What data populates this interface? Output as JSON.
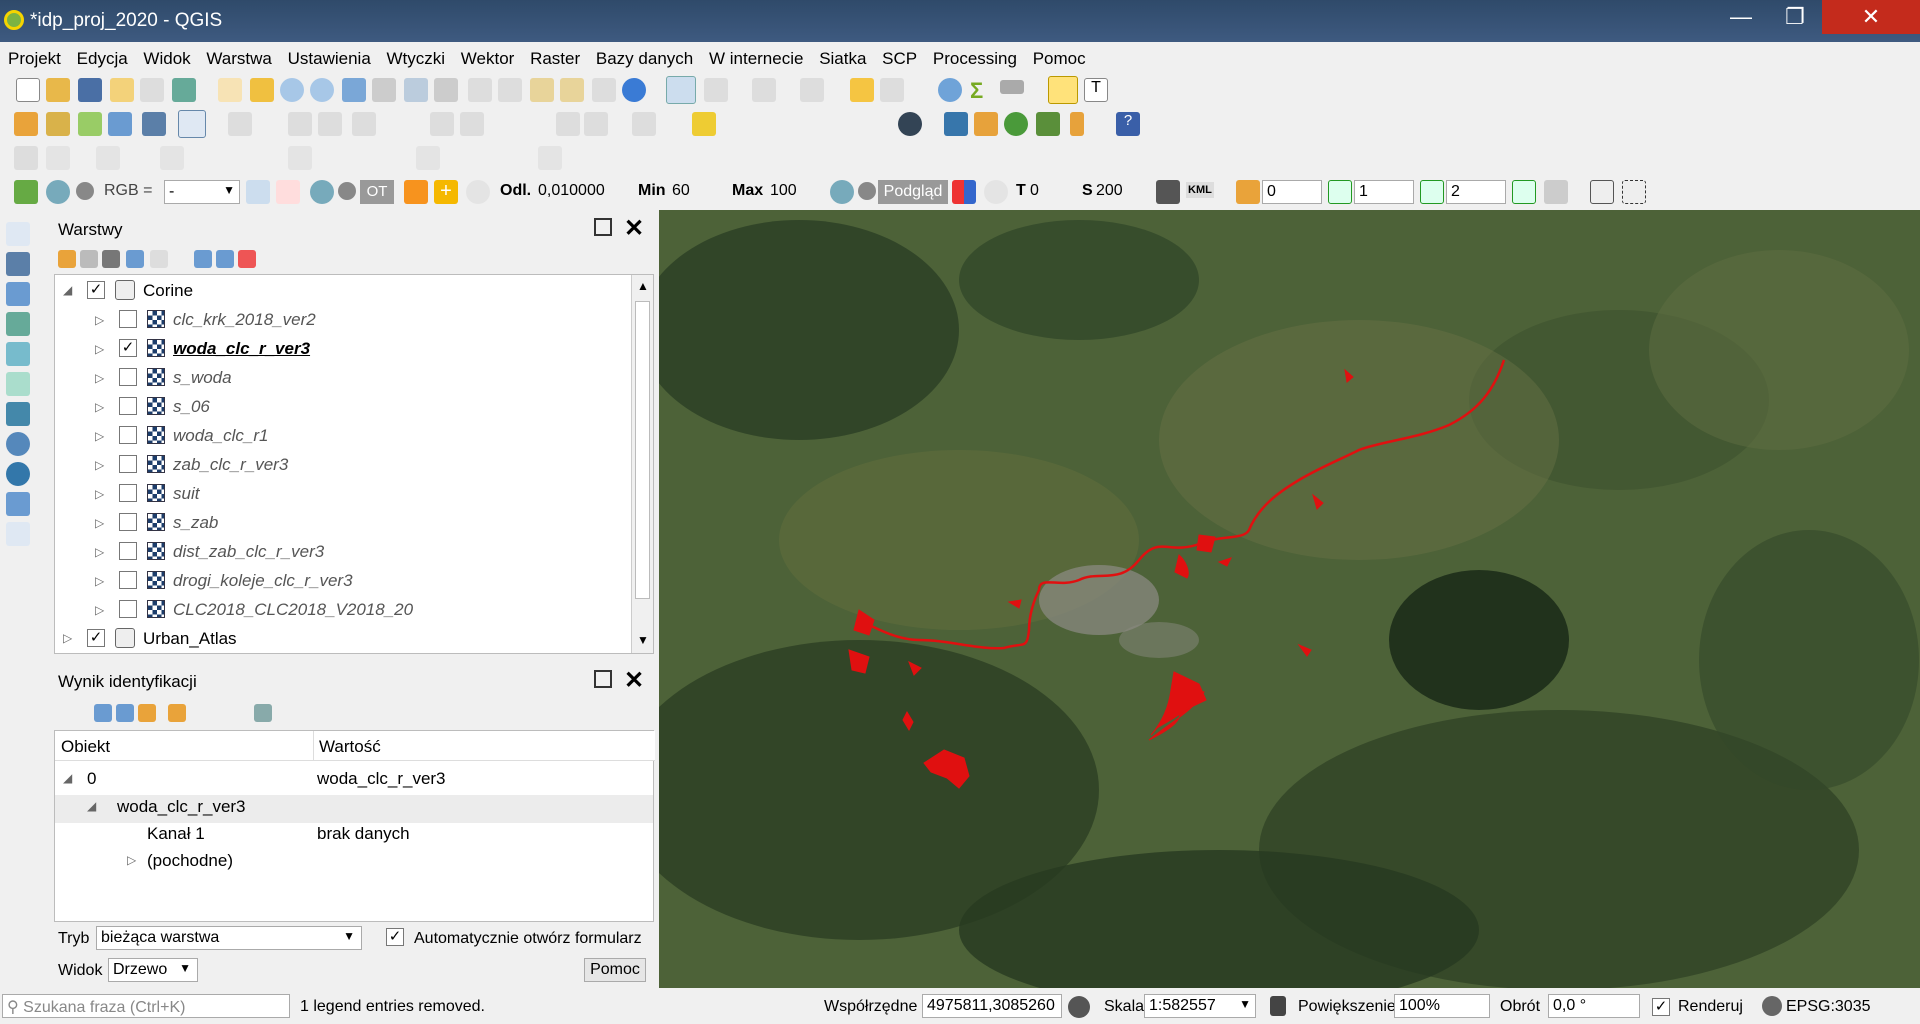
{
  "window": {
    "title": "*idp_proj_2020 - QGIS",
    "min": "—",
    "max": "❐",
    "close": "✕"
  },
  "menu": [
    "Projekt",
    "Edycja",
    "Widok",
    "Warstwa",
    "Ustawienia",
    "Wtyczki",
    "Wektor",
    "Raster",
    "Bazy danych",
    "W internecie",
    "Siatka",
    "SCP",
    "Processing",
    "Pomoc"
  ],
  "scp_toolbar": {
    "rgb_label": "RGB =",
    "rgb_value": "-",
    "ot_label": "OT",
    "odl_label": "Odl.",
    "odl_value": "0,010000",
    "min_label": "Min",
    "min_value": "60",
    "max_label": "Max",
    "max_value": "100",
    "podglad": "Podgląd",
    "t_label": "T",
    "t_value": "0",
    "s_label": "S",
    "s_value": "200",
    "kml": "KML",
    "band0": "0",
    "band1": "1",
    "band2": "2"
  },
  "layers_panel": {
    "title": "Warstwy",
    "groups": [
      {
        "name": "Corine",
        "checked": true
      },
      {
        "name": "Urban_Atlas",
        "checked": true
      }
    ],
    "layers": [
      {
        "name": "clc_krk_2018_ver2",
        "checked": false
      },
      {
        "name": "woda_clc_r_ver3",
        "checked": true
      },
      {
        "name": "s_woda",
        "checked": false
      },
      {
        "name": "s_06",
        "checked": false
      },
      {
        "name": "woda_clc_r1",
        "checked": false
      },
      {
        "name": "zab_clc_r_ver3",
        "checked": false
      },
      {
        "name": "suit",
        "checked": false
      },
      {
        "name": "s_zab",
        "checked": false
      },
      {
        "name": "dist_zab_clc_r_ver3",
        "checked": false
      },
      {
        "name": "drogi_koleje_clc_r_ver3",
        "checked": false
      },
      {
        "name": "CLC2018_CLC2018_V2018_20",
        "checked": false
      }
    ]
  },
  "identify_panel": {
    "title": "Wynik identyfikacji",
    "col_obiekt": "Obiekt",
    "col_wartosc": "Wartość",
    "row0_obj": "0",
    "row0_val": "woda_clc_r_ver3",
    "row1_obj": "woda_clc_r_ver3",
    "row2_obj": "Kanał 1",
    "row2_val": "brak danych",
    "row3_obj": "(pochodne)",
    "tryb_label": "Tryb",
    "tryb_value": "bieżąca warstwa",
    "auto_label": "Automatycznie otwórz formularz",
    "widok_label": "Widok",
    "widok_value": "Drzewo",
    "pomoc": "Pomoc"
  },
  "status": {
    "search_placeholder": "Szukana fraza (Ctrl+K)",
    "message": "1 legend entries removed.",
    "coords_label": "Współrzędne",
    "coords_value": "4975811,3085260",
    "scale_label": "Skala",
    "scale_value": "1:582557",
    "zoom_label": "Powiększenie",
    "zoom_value": "100%",
    "rot_label": "Obrót",
    "rot_value": "0,0 °",
    "render_label": "Renderuj",
    "crs": "EPSG:3035"
  }
}
